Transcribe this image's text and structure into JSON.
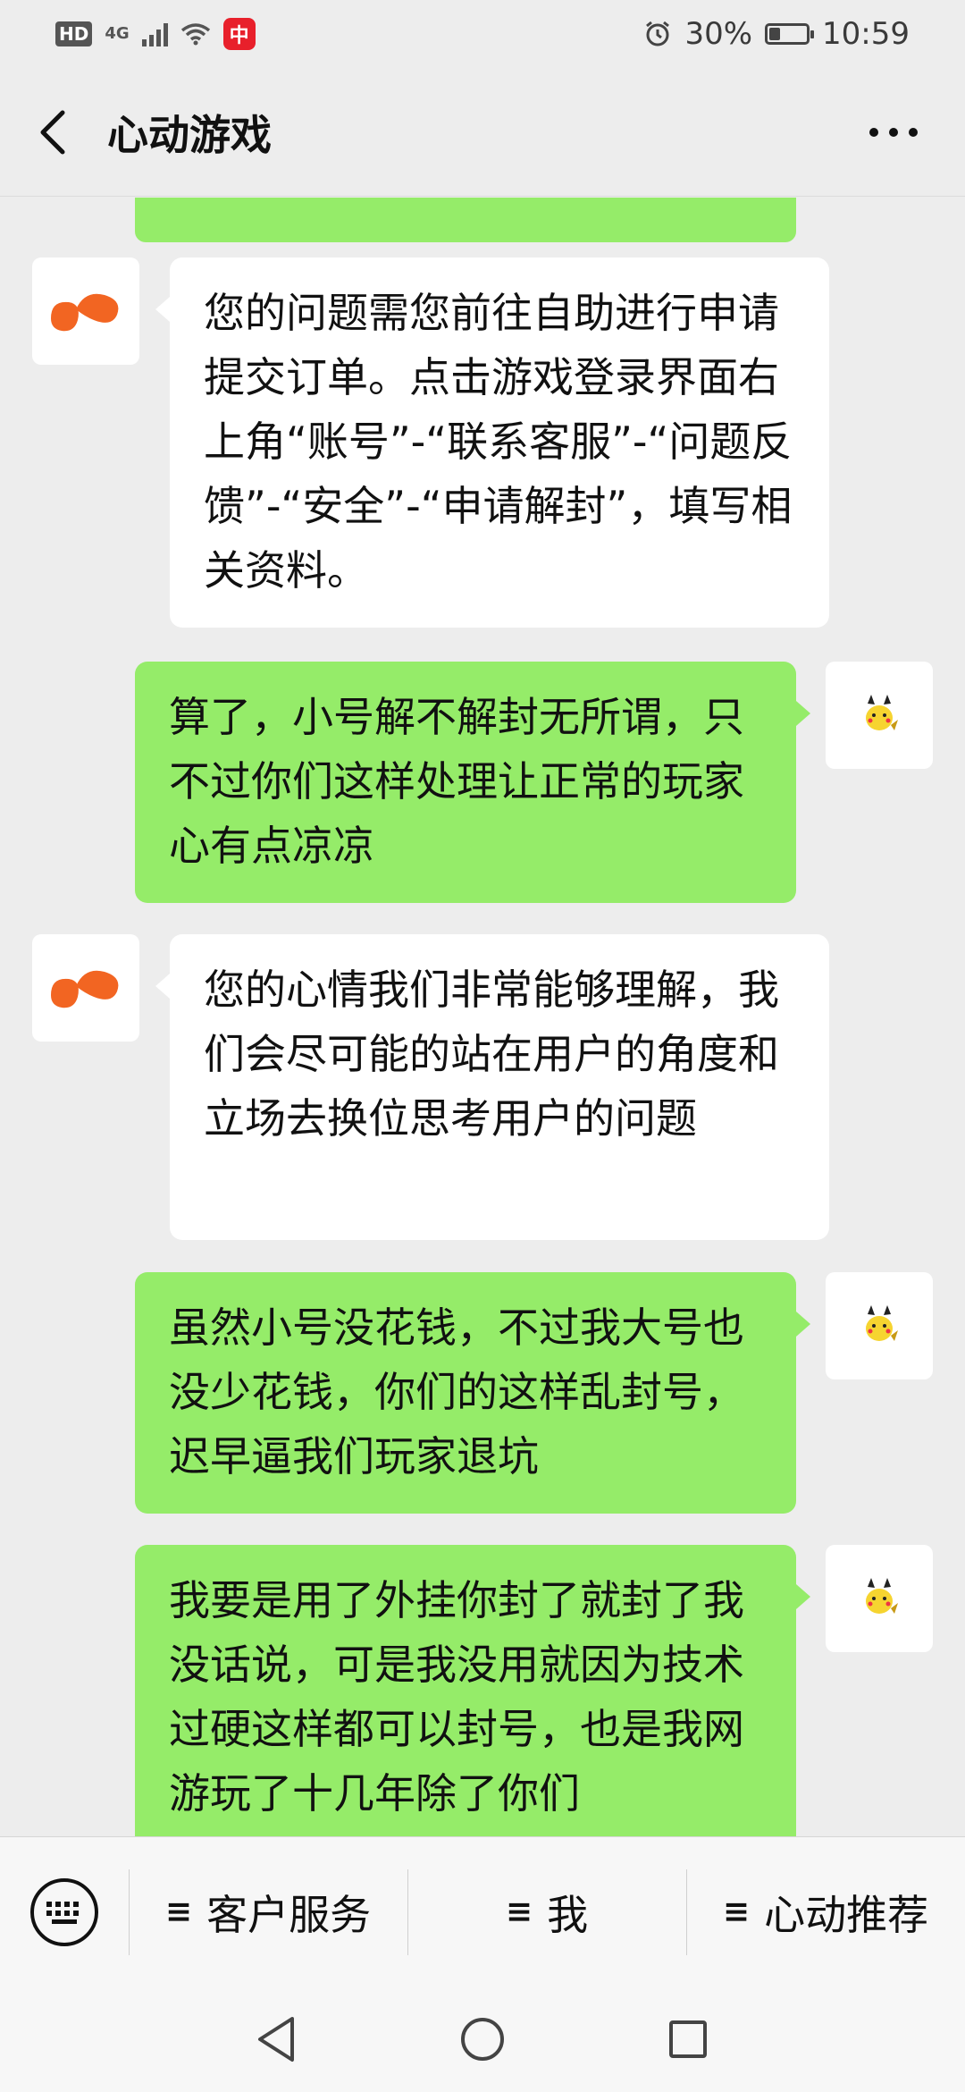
{
  "status_bar": {
    "hd": "HD",
    "network": "4G",
    "app_badge": "中",
    "battery": "30%",
    "battery_level": 0.3,
    "time": "10:59"
  },
  "header": {
    "title": "心动游戏"
  },
  "messages": [
    {
      "side": "left",
      "text": "您的问题需您前往自助进行申请提交订单。点击游戏登录界面右上角“账号”-“联系客服”-“问题反馈”-“安全”-“申请解封”，填写相关资料。"
    },
    {
      "side": "right",
      "text": "算了，小号解不解封无所谓，只不过你们这样处理让正常的玩家心有点凉凉"
    },
    {
      "side": "left",
      "text": "您的心情我们非常能够理解，我们会尽可能的站在用户的角度和立场去换位思考用户的问题"
    },
    {
      "side": "right",
      "text": "虽然小号没花钱，不过我大号也没少花钱，你们的这样乱封号，迟早逼我们玩家退坑"
    },
    {
      "side": "right",
      "text": "我要是用了外挂你封了就封了我没话说，可是我没用就因为技术过硬这样都可以封号，也是我网游玩了十几年除了你们"
    }
  ],
  "menu": {
    "items": [
      {
        "icon": "≡",
        "label": "客户服务"
      },
      {
        "icon": "≡",
        "label": "我"
      },
      {
        "icon": "≡",
        "label": "心动推荐"
      }
    ]
  },
  "colors": {
    "background": "#ededed",
    "incoming_bubble": "#ffffff",
    "outgoing_bubble": "#95ec69",
    "brand_orange": "#f26522"
  },
  "icons": {
    "back": "chevron-left-icon",
    "more": "more-dots-icon",
    "keyboard": "keyboard-icon",
    "service_avatar": "xd-logo-icon",
    "user_avatar": "pikachu-avatar-icon"
  }
}
